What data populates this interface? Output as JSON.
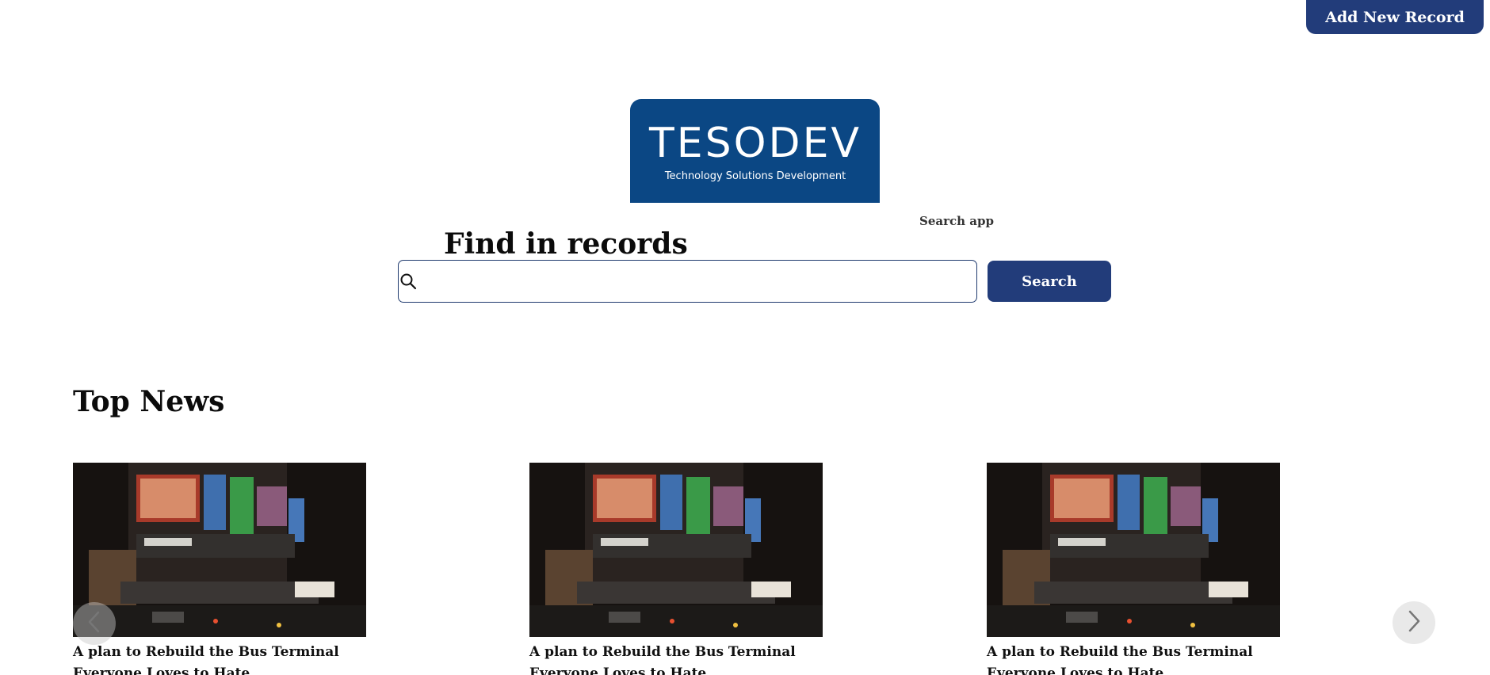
{
  "header": {
    "add_record_label": "Add New Record"
  },
  "logo": {
    "wordmark": "TESODEV",
    "tagline": "Technology Solutions Development"
  },
  "search": {
    "app_label": "Search app",
    "title": "Find in records",
    "input_value": "",
    "placeholder": "",
    "button_label": "Search"
  },
  "news": {
    "title": "Top News",
    "items": [
      {
        "headline": "A plan to Rebuild the Bus Terminal Everyone Loves to Hate"
      },
      {
        "headline": "A plan to Rebuild the Bus Terminal Everyone Loves to Hate"
      },
      {
        "headline": "A plan to Rebuild the Bus Terminal Everyone Loves to Hate"
      }
    ],
    "prev_icon": "chevron-left-icon",
    "next_icon": "chevron-right-icon"
  },
  "colors": {
    "primary": "#223c7a",
    "logo_bg": "#0b4784"
  }
}
